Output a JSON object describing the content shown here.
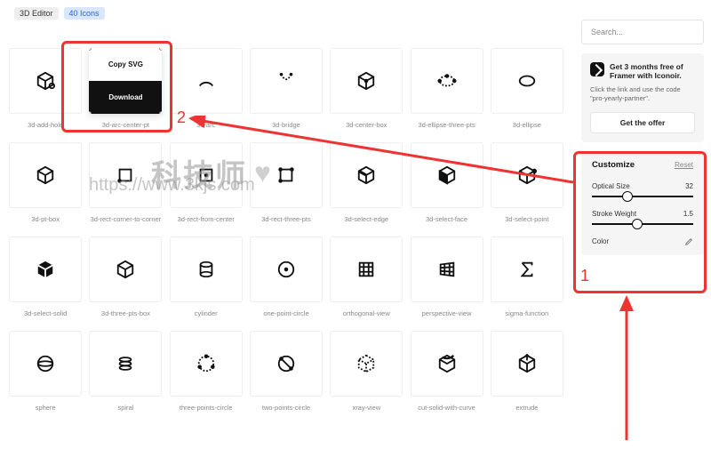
{
  "tags": {
    "editor": "3D Editor",
    "count": "40 Icons"
  },
  "dropdown": {
    "copy": "Copy SVG",
    "download": "Download"
  },
  "icons": [
    "3d-add-hole",
    "3d-arc-center-pt",
    "3d-arc",
    "3d-bridge",
    "3d-center-box",
    "3d-ellipse-three-pts",
    "3d-ellipse",
    "3d-pt-box",
    "3d-rect-corner-to-corner",
    "3d-rect-from-center",
    "3d-rect-three-pts",
    "3d-select-edge",
    "3d-select-face",
    "3d-select-point",
    "3d-select-solid",
    "3d-three-pts-box",
    "cylinder",
    "one-point-circle",
    "orthogonal-view",
    "perspective-view",
    "sigma-function",
    "sphere",
    "spiral",
    "three-points-circle",
    "two-points-circle",
    "xray-view",
    "cut-solid-with-curve",
    "extrude"
  ],
  "search": {
    "placeholder": "Search..."
  },
  "offer": {
    "title": "Get 3 months free of Framer with Iconoir.",
    "desc": "Click the link and use the code \"pro-yearly-partner\".",
    "button": "Get the offer"
  },
  "customize": {
    "title": "Customize",
    "reset": "Reset",
    "optical_label": "Optical Size",
    "optical_value": "32",
    "stroke_label": "Stroke Weight",
    "stroke_value": "1.5",
    "color_label": "Color"
  },
  "annotations": {
    "one": "1",
    "two": "2"
  },
  "watermark": {
    "cn": "科技师",
    "url": "https://www.3kjs.com"
  }
}
